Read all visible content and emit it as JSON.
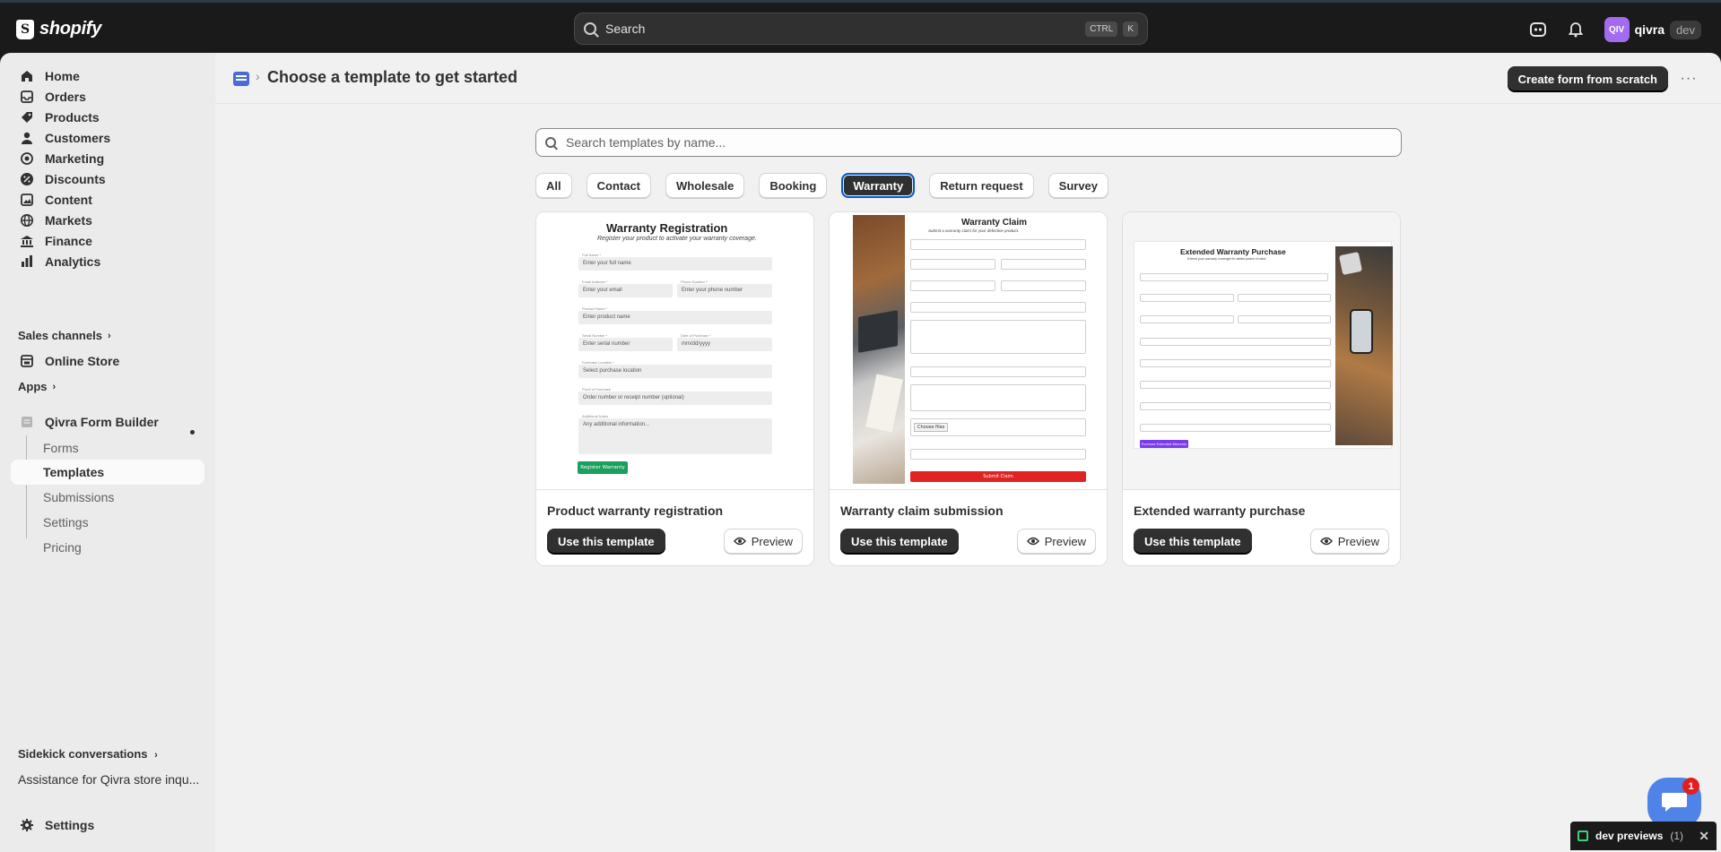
{
  "topbar": {
    "brand": "shopify",
    "search_placeholder": "Search",
    "shortcut_keys": [
      "CTRL",
      "K"
    ],
    "avatar_initials": "QIV",
    "account_name": "qivra",
    "store_badge": "dev"
  },
  "sidebar": {
    "items": [
      {
        "label": "Home",
        "icon": "home-icon"
      },
      {
        "label": "Orders",
        "icon": "inbox-icon"
      },
      {
        "label": "Products",
        "icon": "tag-icon"
      },
      {
        "label": "Customers",
        "icon": "person-icon"
      },
      {
        "label": "Marketing",
        "icon": "target-icon"
      },
      {
        "label": "Discounts",
        "icon": "discount-icon"
      },
      {
        "label": "Content",
        "icon": "content-icon"
      },
      {
        "label": "Markets",
        "icon": "globe-icon"
      },
      {
        "label": "Finance",
        "icon": "bank-icon"
      },
      {
        "label": "Analytics",
        "icon": "chart-icon"
      }
    ],
    "sales_channels_label": "Sales channels",
    "online_store_label": "Online Store",
    "apps_label": "Apps",
    "app_name": "Qivra Form Builder",
    "app_subitems": [
      "Forms",
      "Templates",
      "Submissions",
      "Settings",
      "Pricing"
    ],
    "active_subitem": "Templates",
    "sidekick_label": "Sidekick conversations",
    "sidekick_item": "Assistance for Qivra store inqu...",
    "settings_label": "Settings"
  },
  "page": {
    "title": "Choose a template to get started",
    "primary_action": "Create form from scratch",
    "more_actions": "···",
    "search_placeholder": "Search templates by name...",
    "filters": [
      "All",
      "Contact",
      "Wholesale",
      "Booking",
      "Warranty",
      "Return request",
      "Survey"
    ],
    "active_filter": "Warranty"
  },
  "templates": [
    {
      "name": "Product warranty registration",
      "use_label": "Use this template",
      "preview_label": "Preview",
      "preview": {
        "title": "Warranty Registration",
        "subtitle": "Register your product to activate your warranty coverage.",
        "fields": [
          {
            "label": "Full Name *",
            "placeholder": "Enter your full name"
          },
          {
            "label": "Email Address *",
            "placeholder": "Enter your email"
          },
          {
            "label": "Phone Number *",
            "placeholder": "Enter your phone number"
          },
          {
            "label": "Product Name *",
            "placeholder": "Enter product name"
          },
          {
            "label": "Serial Number *",
            "placeholder": "Enter serial number"
          },
          {
            "label": "Date of Purchase *",
            "placeholder": "mm/dd/yyyy"
          },
          {
            "label": "Purchase Location *",
            "placeholder": "Select purchase location"
          },
          {
            "label": "Proof of Purchase",
            "placeholder": "Order number or receipt number (optional)"
          },
          {
            "label": "Additional Notes",
            "placeholder": "Any additional information..."
          }
        ],
        "submit": "Register Warranty",
        "accent": "#1a9f5c"
      }
    },
    {
      "name": "Warranty claim submission",
      "use_label": "Use this template",
      "preview_label": "Preview",
      "preview": {
        "title": "Warranty Claim",
        "subtitle": "Submit a warranty claim for your defective product.",
        "upload_label": "Choose files",
        "submit": "Submit Claim",
        "accent": "#e02424"
      }
    },
    {
      "name": "Extended warranty purchase",
      "use_label": "Use this template",
      "preview_label": "Preview",
      "preview": {
        "title": "Extended Warranty Purchase",
        "subtitle": "Extend your warranty coverage for added peace of mind.",
        "submit": "Purchase Extended Warranty",
        "accent": "#7c3aed"
      }
    }
  ],
  "floating": {
    "chat_badge": "1",
    "dev_previews_label": "dev previews",
    "dev_previews_count": "(1)"
  }
}
